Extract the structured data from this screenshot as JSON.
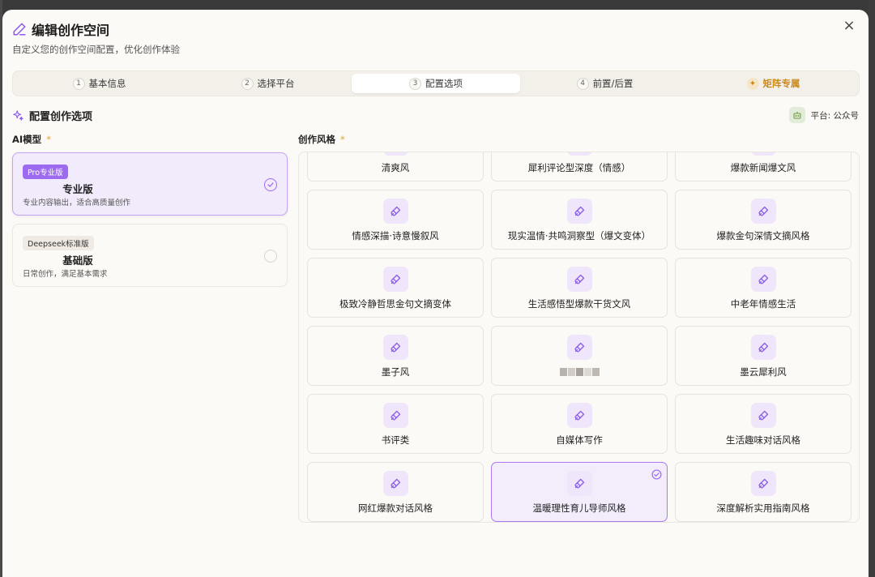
{
  "dialog": {
    "title": "编辑创作空间",
    "subtitle": "自定义您的创作空间配置，优化创作体验",
    "close_label": "×"
  },
  "steps": [
    {
      "num": "1",
      "label": "基本信息"
    },
    {
      "num": "2",
      "label": "选择平台"
    },
    {
      "num": "3",
      "label": "配置选项"
    },
    {
      "num": "4",
      "label": "前置/后置"
    },
    {
      "num": "",
      "label": "矩阵专属"
    }
  ],
  "active_step": 2,
  "section": {
    "title": "配置创作选项",
    "platform": "平台: 公众号"
  },
  "ai_model": {
    "label": "AI模型",
    "required": "*",
    "options": [
      {
        "badge": "Pro专业版",
        "name": "专业版",
        "desc": "专业内容输出，适合高质量创作",
        "selected": true
      },
      {
        "badge": "Deepseek标准版",
        "name": "基础版",
        "desc": "日常创作，满足基本需求",
        "selected": false
      }
    ]
  },
  "style": {
    "label": "创作风格",
    "required": "*",
    "options": [
      {
        "label": "清爽风",
        "selected": false
      },
      {
        "label": "犀利评论型深度（情感）",
        "selected": false
      },
      {
        "label": "爆款新闻爆文风",
        "selected": false
      },
      {
        "label": "情感深描·诗意慢叙风",
        "selected": false
      },
      {
        "label": "现实温情·共鸣洞察型（爆文变体）",
        "selected": false
      },
      {
        "label": "爆款金句深情文摘风格",
        "selected": false
      },
      {
        "label": "极致冷静哲思金句文摘变体",
        "selected": false
      },
      {
        "label": "生活感悟型爆款干货文风",
        "selected": false
      },
      {
        "label": "中老年情感生活",
        "selected": false
      },
      {
        "label": "墨子风",
        "selected": false
      },
      {
        "label": "",
        "selected": false,
        "obscured": true
      },
      {
        "label": "墨云犀利风",
        "selected": false
      },
      {
        "label": "书评类",
        "selected": false
      },
      {
        "label": "自媒体写作",
        "selected": false
      },
      {
        "label": "生活趣味对话风格",
        "selected": false
      },
      {
        "label": "网红爆款对话风格",
        "selected": false
      },
      {
        "label": "温暖理性育儿导师风格",
        "selected": true
      },
      {
        "label": "深度解析实用指南风格",
        "selected": false
      }
    ]
  },
  "colors": {
    "accent": "#9d6bf0",
    "matrix_gold": "#c98a1a",
    "required_star": "#d7a53a"
  }
}
